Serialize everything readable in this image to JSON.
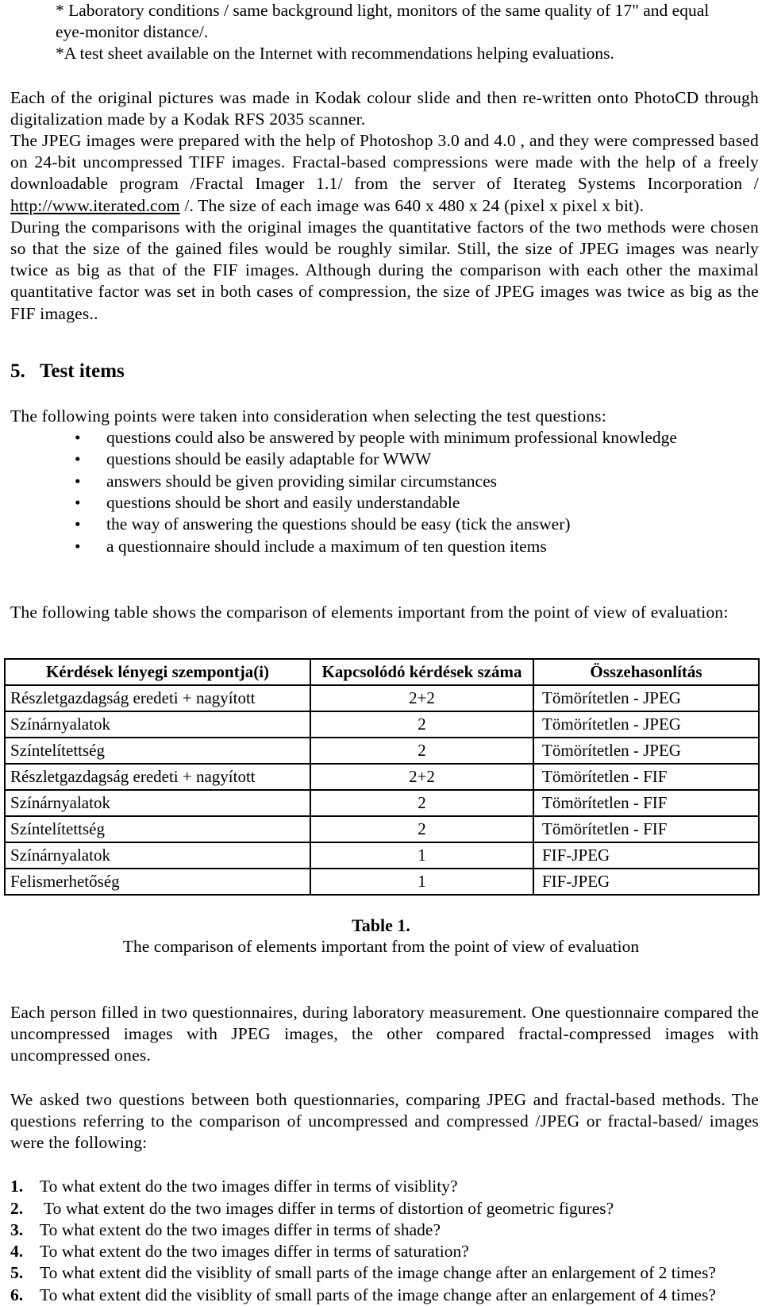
{
  "intro_notes": {
    "line1": "* Laboratory conditions / same background light, monitors of the same quality of 17\" and equal",
    "line2": "eye-monitor distance/.",
    "line3": "*A test sheet available on the Internet with recommendations helping evaluations."
  },
  "paragraphs": {
    "p1": "Each of the original pictures was made in Kodak colour slide and then re-written onto PhotoCD through digitalization made by a Kodak RFS 2035 scanner.",
    "p2_before_link": "The JPEG images were prepared with the help of  Photoshop 3.0 and 4.0 , and they were compressed based on 24-bit uncompressed  TIFF images. Fractal-based compressions were made with the help of a freely downloadable program /Fractal Imager 1.1/ from the server of Iterateg Systems Incorporation / ",
    "p2_link": "http://www.iterated.com",
    "p2_after_link": " /. The size of each image was  640 x 480 x 24 (pixel x pixel x bit).",
    "p3": "During the comparisons with the original images the quantitative factors of the two methods were chosen so that the size of the gained files would be roughly similar. Still, the size of JPEG images was nearly twice as big as that of the FIF images. Although during the comparison with each other the maximal quantitative factor was set in both cases of compression, the size of JPEG images was twice as big as the FIF images..",
    "p4": "The following points were taken into consideration when selecting the test questions:",
    "p5": "The following table shows the comparison of elements important from the point of view of evaluation:",
    "p6": "Each person filled in two questionnaires, during laboratory measurement. One questionnaire compared the uncompressed images with JPEG images, the other compared fractal-compressed images with uncompressed ones.",
    "p7": "We asked two  questions between both questionnaries, comparing JPEG and fractal-based methods. The questions referring to the comparison of uncompressed and compressed /JPEG or fractal-based/ images were the following:"
  },
  "section": {
    "number": "5.",
    "title": "Test items",
    "heading_full": "5.   Test items"
  },
  "bullet_marker": "•",
  "bullets": [
    "questions could also be answered by people with minimum professional knowledge",
    "questions should be easily adaptable for WWW",
    "answers should be given providing similar circumstances",
    "questions should be short and easily understandable",
    "the way of answering the questions should be easy (tick the answer)",
    "a questionnaire should include a maximum of ten question items"
  ],
  "table": {
    "headers": [
      "Kérdések lényegi szempontja(i)",
      "Kapcsolódó kérdések száma",
      "Összehasonlítás"
    ],
    "rows": [
      {
        "aspect": "Részletgazdagság eredeti + nagyított",
        "count": "2+2",
        "comparison": "Tömörítetlen - JPEG"
      },
      {
        "aspect": "Színárnyalatok",
        "count": "2",
        "comparison": "Tömörítetlen - JPEG"
      },
      {
        "aspect": "Színtelítettség",
        "count": "2",
        "comparison": "Tömörítetlen - JPEG"
      },
      {
        "aspect": "Részletgazdagság eredeti + nagyított",
        "count": "2+2",
        "comparison": "Tömörítetlen - FIF"
      },
      {
        "aspect": "Színárnyalatok",
        "count": "2",
        "comparison": "Tömörítetlen - FIF"
      },
      {
        "aspect": "Színtelítettség",
        "count": "2",
        "comparison": "Tömörítetlen - FIF"
      },
      {
        "aspect": "Színárnyalatok",
        "count": "1",
        "comparison": "FIF-JPEG"
      },
      {
        "aspect": "Felismerhetőség",
        "count": "1",
        "comparison": "FIF-JPEG"
      }
    ]
  },
  "caption": {
    "title": "Table 1.",
    "subtitle": "The comparison of elements important from the point of view of evaluation"
  },
  "questions": [
    {
      "num": "1.",
      "text": "To what extent do the two images differ in terms of visiblity?"
    },
    {
      "num": "2.",
      "text": " To what extent do the two images differ in terms of distortion of geometric figures?"
    },
    {
      "num": "3.",
      "text": "To what extent do the two images differ in terms of shade?"
    },
    {
      "num": "4.",
      "text": "To what extent do the two images differ in terms of saturation?"
    },
    {
      "num": "5.",
      "text": "To what extent did the visiblity of small parts of the image change after an enlargement of 2 times?"
    },
    {
      "num": "6.",
      "text": "To what extent did the visiblity of small parts of the image change after an enlargement of 4 times?"
    }
  ],
  "colors": {
    "text": "#000000",
    "background": "#ffffff",
    "table_border": "#000000"
  }
}
